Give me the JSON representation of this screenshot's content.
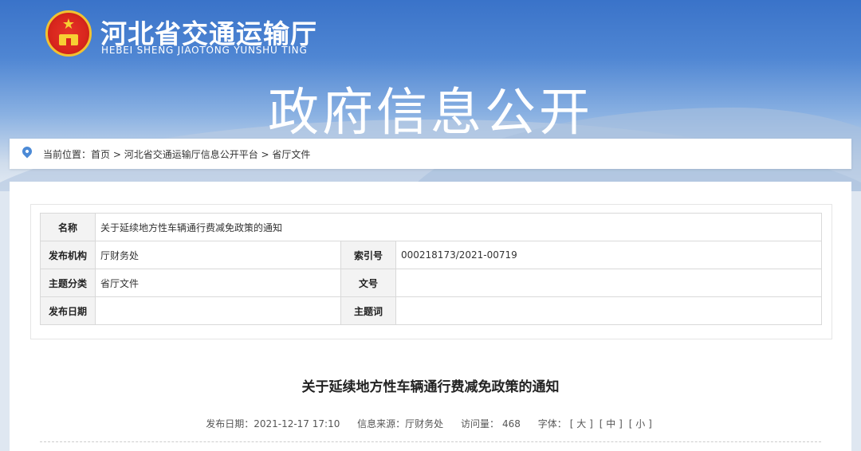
{
  "header": {
    "org_name_cn": "河北省交通运输厅",
    "org_name_en": "HEBEI SHENG JIAOTONG YUNSHU TING",
    "banner_title": "政府信息公开"
  },
  "breadcrumb": {
    "prefix": "当前位置：",
    "items": [
      "首页",
      "河北省交通运输厅信息公开平台",
      "省厅文件"
    ],
    "separator": " > "
  },
  "info_table": {
    "name_label": "名称",
    "name_value": "关于延续地方性车辆通行费减免政策的通知",
    "issuer_label": "发布机构",
    "issuer_value": "厅财务处",
    "index_label": "索引号",
    "index_value": "000218173/2021-00719",
    "category_label": "主题分类",
    "category_value": "省厅文件",
    "docno_label": "文号",
    "docno_value": "",
    "date_label": "发布日期",
    "date_value": "",
    "keywords_label": "主题词",
    "keywords_value": ""
  },
  "article": {
    "title": "关于延续地方性车辆通行费减免政策的通知",
    "publish_date": "发布日期：2021-12-17 17:10",
    "source": "信息来源：厅财务处",
    "visits_label": "访问量：",
    "visits": "468",
    "font_label": "字体：",
    "font_large": "[ 大 ]",
    "font_medium": "[ 中 ]",
    "font_small": "[ 小 ]"
  },
  "colors": {
    "banner_top": "#3a73c9",
    "accent_blue": "#4c8ad6",
    "emblem_red": "#d8261d",
    "emblem_gold": "#f2c230"
  }
}
